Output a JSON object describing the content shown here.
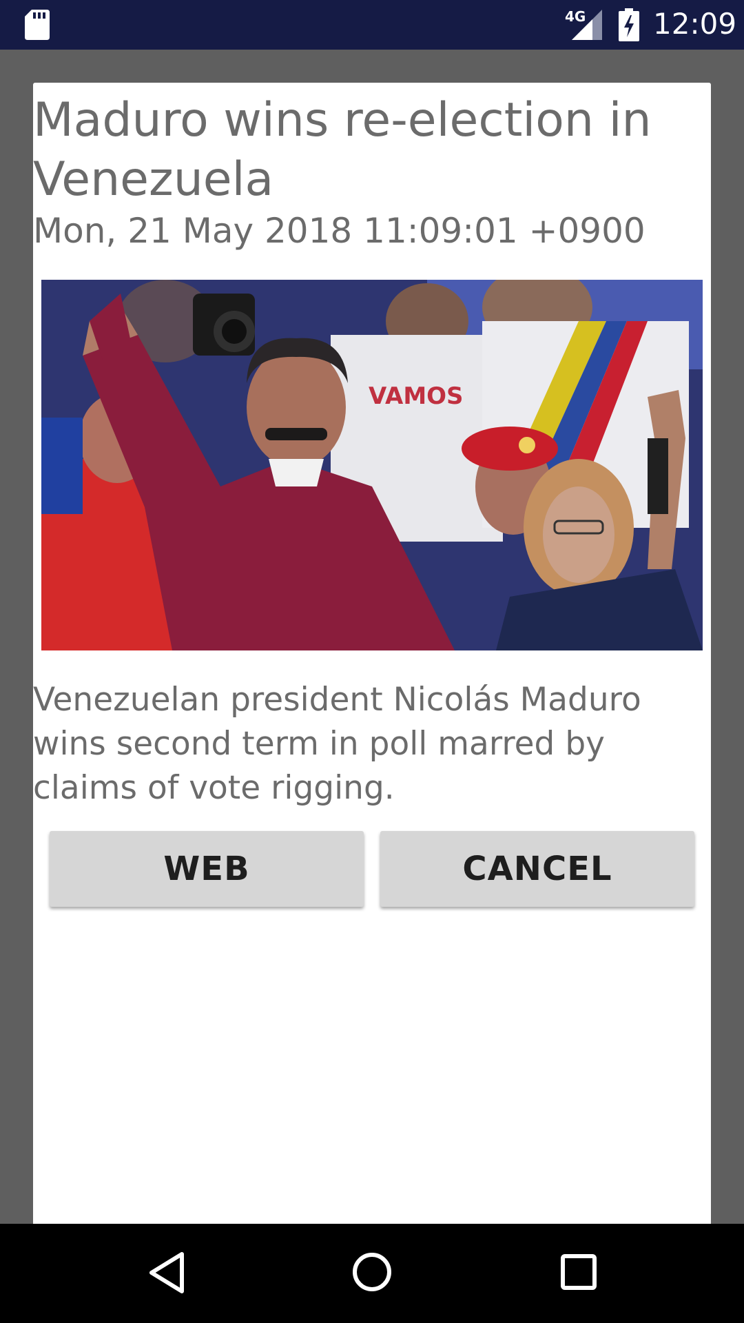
{
  "status_bar": {
    "network": "4G",
    "time": "12:09",
    "icons": [
      "sd-card-icon",
      "signal-icon",
      "battery-charging-icon"
    ]
  },
  "dialog": {
    "title": "Maduro wins re-election in Venezuela",
    "date": "Mon, 21 May 2018 11:09:01 +0900",
    "image": "news-photo",
    "description": "Venezuelan president Nicolás Maduro wins second term in poll marred by claims of vote rigging.",
    "buttons": {
      "web_label": "WEB",
      "cancel_label": "CANCEL"
    }
  },
  "nav_bar": {
    "icons": [
      "back-icon",
      "home-icon",
      "recents-icon"
    ]
  },
  "colors": {
    "status_bar": "#151b45",
    "scrim": "#5f5f5f",
    "dialog_bg": "#ffffff",
    "text": "#6b6b6b",
    "button_bg": "#d6d6d6",
    "nav_bar": "#000000"
  }
}
